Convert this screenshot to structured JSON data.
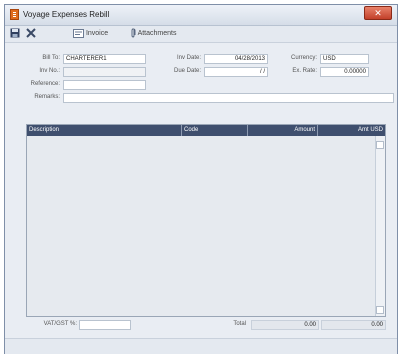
{
  "window": {
    "title": "Voyage Expenses Rebill",
    "close_glyph": "✕"
  },
  "toolbar": {
    "save_icon": "floppy-disk-icon",
    "delete_icon": "x-icon",
    "invoice_label": "Invoice",
    "attachments_label": "Attachments"
  },
  "form": {
    "bill_to_label": "Bill To:",
    "bill_to_value": "CHARTERER1",
    "inv_no_label": "Inv No.:",
    "inv_no_value": "",
    "reference_label": "Reference:",
    "reference_value": "",
    "remarks_label": "Remarks:",
    "remarks_value": "",
    "inv_date_label": "Inv Date:",
    "inv_date_value": "04/28/2013",
    "due_date_label": "Due Date:",
    "due_date_value": "/ /",
    "currency_label": "Currency:",
    "currency_value": "USD",
    "exch_rate_label": "Ex. Rate:",
    "exch_rate_value": "0.00000"
  },
  "grid": {
    "columns": [
      "Description",
      "Code",
      "Amount",
      "Amt USD"
    ]
  },
  "footer": {
    "vat_label": "VAT/GST %:",
    "vat_value": "",
    "total_label": "Total",
    "total_amount": "0.00",
    "total_usd": "0.00"
  }
}
